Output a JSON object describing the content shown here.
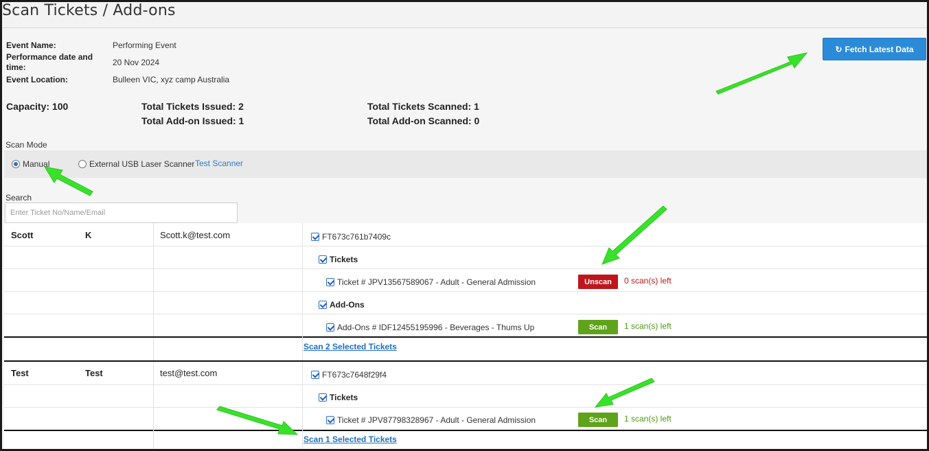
{
  "page": {
    "title": "Scan Tickets / Add-ons"
  },
  "event": {
    "name_label": "Event Name:",
    "name_value": "Performing Event",
    "date_label": "Performance date and time:",
    "date_value": "20 Nov 2024",
    "location_label": "Event Location:",
    "location_value": "Bulleen VIC, xyz camp Australia"
  },
  "fetch_button": {
    "label": "Fetch Latest Data",
    "icon": "refresh-icon",
    "color": "#2b8bd8"
  },
  "stats": {
    "capacity": "Capacity: 100",
    "tickets_issued": "Total Tickets Issued: 2",
    "addons_issued": "Total Add-on Issued: 1",
    "tickets_scanned": "Total Tickets Scanned: 1",
    "addons_scanned": "Total Add-on Scanned: 0"
  },
  "scan_mode": {
    "label": "Scan Mode",
    "options": [
      {
        "label": "Manual",
        "selected": true
      },
      {
        "label": "External USB Laser Scanner",
        "selected": false
      }
    ],
    "test_link": "Test Scanner"
  },
  "search": {
    "label": "Search",
    "placeholder": "Enter Ticket No/Name/Email",
    "value": ""
  },
  "orders": [
    {
      "first_name": "Scott",
      "last_name": "K",
      "email": "Scott.k@test.com",
      "order_id": "FT673c761b7409c",
      "tickets_heading": "Tickets",
      "ticket_item": "Ticket # JPV13567589067 - Adult - General Admission",
      "ticket_button": "Unscan",
      "ticket_scans_left": "0 scan(s) left",
      "addons_heading": "Add-Ons",
      "addon_item": "Add-Ons # IDF12455195996 - Beverages - Thums Up",
      "addon_button": "Scan",
      "addon_scans_left": "1 scan(s) left",
      "scan_selected": "Scan 2 Selected Tickets"
    },
    {
      "first_name": "Test",
      "last_name": "Test",
      "email": "test@test.com",
      "order_id": "FT673c7648f29f4",
      "tickets_heading": "Tickets",
      "ticket_item": "Ticket # JPV87798328967 - Adult - General Admission",
      "ticket_button": "Scan",
      "ticket_scans_left": "1 scan(s) left",
      "scan_selected": "Scan 1 Selected Tickets"
    }
  ],
  "colors": {
    "unscan": "#c0151c",
    "scan": "#5fa31a",
    "annotation_arrow": "#39e22a"
  }
}
